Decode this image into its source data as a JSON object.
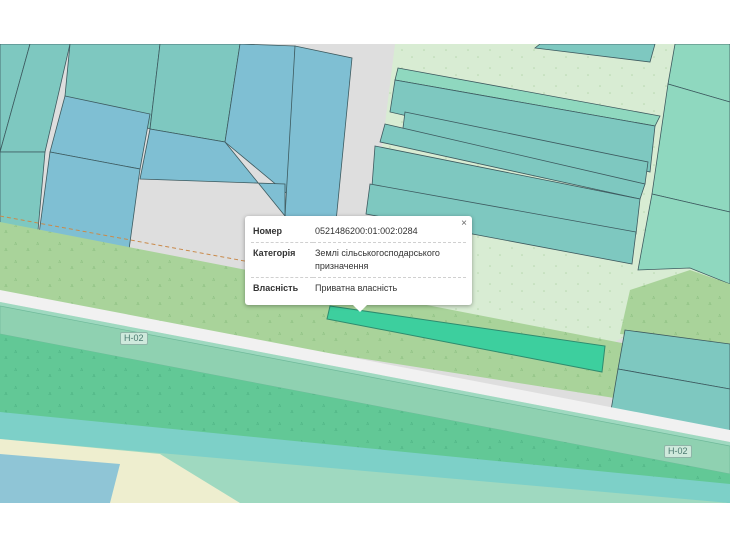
{
  "popup": {
    "close_label": "×",
    "rows": [
      {
        "key": "Номер",
        "value": "0521486200:01:002:0284"
      },
      {
        "key": "Категорія",
        "value": "Землі сільськогосподарського призначення"
      },
      {
        "key": "Власність",
        "value": "Приватна власність"
      }
    ]
  },
  "roads": {
    "label_1": "Н-02",
    "label_2": "Н-02"
  },
  "colors": {
    "parcel_blue": "#7fbfd3",
    "parcel_teal": "#7ec8c0",
    "parcel_mint": "#8fd8bf",
    "selected_parcel": "#3dcf9e",
    "vegetation": "#a9d39a",
    "road_band": "#5fc795",
    "land_light": "#d8ecd3"
  }
}
